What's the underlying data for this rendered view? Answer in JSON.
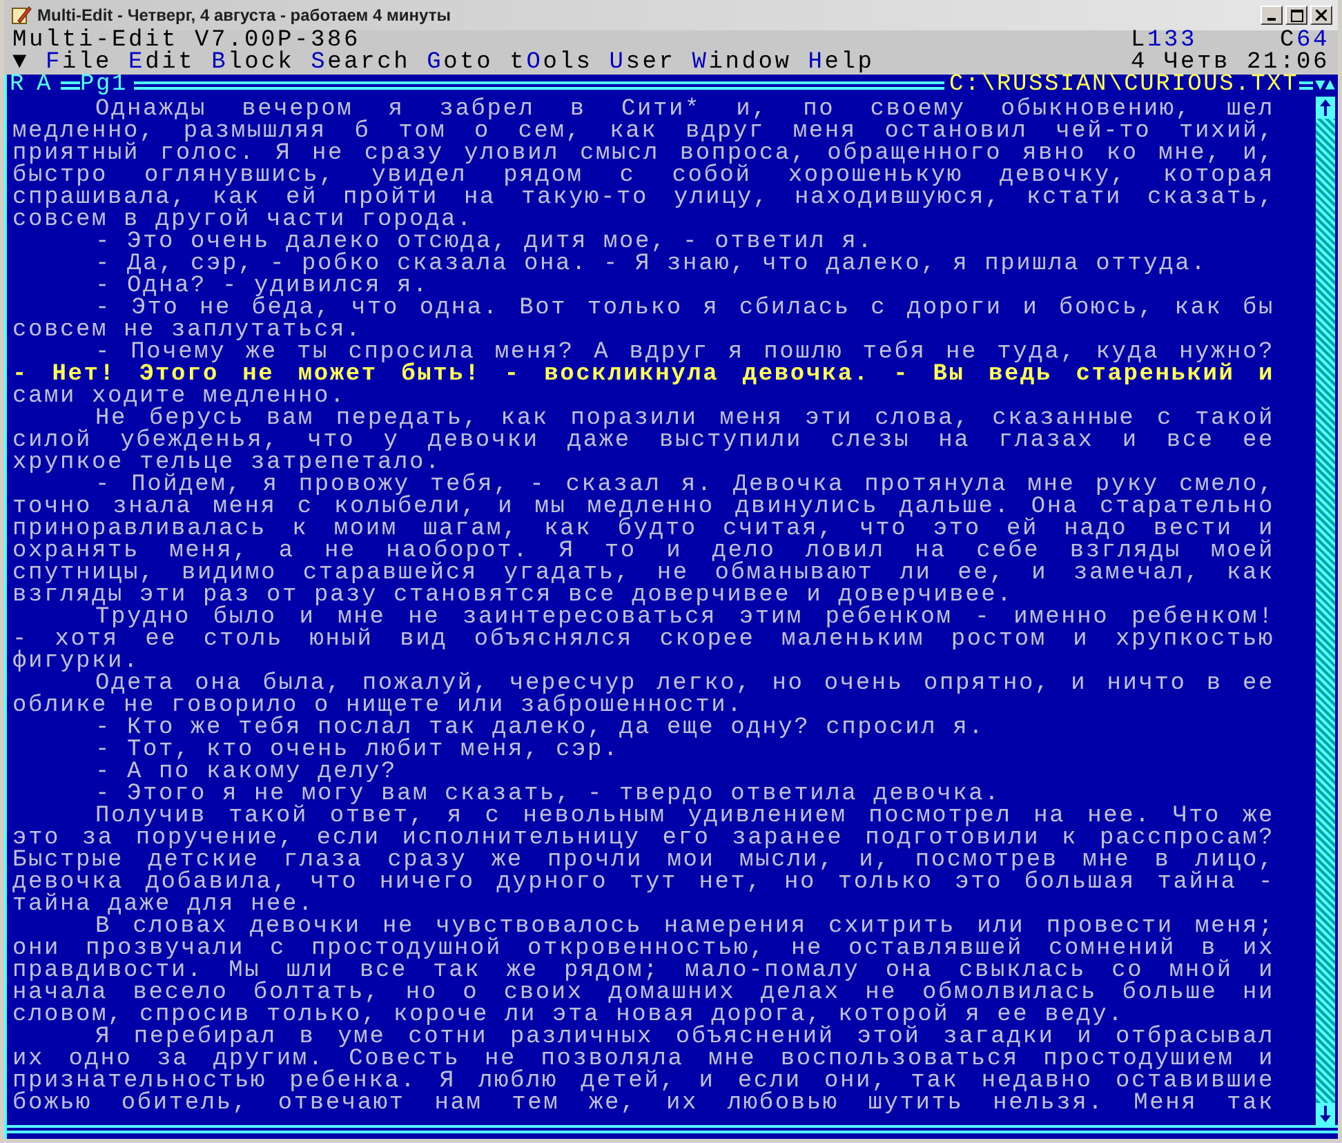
{
  "window": {
    "title": "Multi-Edit - Четверг, 4 августа - работаем 4 минуты"
  },
  "app_line": {
    "version": "Multi-Edit V7.00P-386",
    "line": {
      "label": "L",
      "value": "133"
    },
    "column": {
      "label": "C",
      "value": "64"
    }
  },
  "menu": {
    "arrow": "▼",
    "items": [
      {
        "key": "F",
        "post": "ile"
      },
      {
        "key": "E",
        "post": "dit"
      },
      {
        "key": "B",
        "post": "lock"
      },
      {
        "key": "S",
        "post": "earch"
      },
      {
        "key": "G",
        "post": "oto"
      },
      {
        "pre": "t",
        "key": "O",
        "post": "ols"
      },
      {
        "key": "U",
        "post": "ser"
      },
      {
        "key": "W",
        "post": "indow"
      },
      {
        "key": "H",
        "post": "elp"
      }
    ],
    "date": "4 Четв",
    "time": "21:06"
  },
  "frame": {
    "mode_r": "R",
    "mode_a": "A",
    "page": "Pg1",
    "path": "C:\\RUSSIAN\\CURIOUS.TXT",
    "arrows": "▼▲"
  },
  "lines": [
    {
      "text": "Однажды вечером я забрел в Сити* и, по своему обыкновению, шел",
      "indent": true,
      "justified": true,
      "highlighted": false
    },
    {
      "text": "медленно, размышляя б том о сем, как вдруг меня остановил чей-то тихий,",
      "indent": false,
      "justified": true,
      "highlighted": false
    },
    {
      "text": "приятный голос. Я не сразу уловил смысл вопроса, обращенного явно ко мне, и,",
      "indent": false,
      "justified": true,
      "highlighted": false
    },
    {
      "text": "быстро оглянувшись, увидел рядом с собой хорошенькую девочку, которая",
      "indent": false,
      "justified": true,
      "highlighted": false
    },
    {
      "text": "спрашивала, как ей пройти на такую-то улицу, находившуюся, кстати сказать,",
      "indent": false,
      "justified": true,
      "highlighted": false
    },
    {
      "text": "совсем в другой части города.",
      "indent": false,
      "justified": false,
      "highlighted": false
    },
    {
      "text": "- Это очень далеко отсюда, дитя мое, - ответил я.",
      "indent": true,
      "justified": false,
      "highlighted": false
    },
    {
      "text": "- Да, сэр, - робко сказала она. - Я знаю, что далеко, я пришла оттуда.",
      "indent": true,
      "justified": false,
      "highlighted": false
    },
    {
      "text": "- Одна? - удивился я.",
      "indent": true,
      "justified": false,
      "highlighted": false
    },
    {
      "text": "- Это не беда, что одна. Вот только я сбилась с дороги и боюсь, как бы",
      "indent": true,
      "justified": true,
      "highlighted": false
    },
    {
      "text": "совсем не заплутаться.",
      "indent": false,
      "justified": false,
      "highlighted": false
    },
    {
      "text": "- Почему же ты спросила меня? А вдруг я пошлю тебя не туда, куда нужно?",
      "indent": true,
      "justified": true,
      "highlighted": false
    },
    {
      "text": "- Нет! Этого не может быть! - воскликнула девочка. - Вы ведь старенький и",
      "indent": false,
      "justified": true,
      "highlighted": true
    },
    {
      "text": "сами ходите медленно.",
      "indent": false,
      "justified": false,
      "highlighted": false
    },
    {
      "text": "Не берусь вам передать, как поразили меня эти слова, сказанные с такой",
      "indent": true,
      "justified": true,
      "highlighted": false
    },
    {
      "text": "силой убежденья, что у девочки даже выступили слезы на глазах и все ее",
      "indent": false,
      "justified": true,
      "highlighted": false
    },
    {
      "text": "хрупкое тельце затрепетало.",
      "indent": false,
      "justified": false,
      "highlighted": false
    },
    {
      "text": "- Пойдем, я провожу тебя, - сказал я. Девочка протянула мне руку смело,",
      "indent": true,
      "justified": true,
      "highlighted": false
    },
    {
      "text": "точно знала меня с колыбели, и мы медленно двинулись дальше. Она старательно",
      "indent": false,
      "justified": true,
      "highlighted": false
    },
    {
      "text": "приноравливалась к моим шагам, как будто считая, что это ей надо вести и",
      "indent": false,
      "justified": true,
      "highlighted": false
    },
    {
      "text": "охранять меня, а не наоборот. Я то и дело ловил на себе взгляды моей",
      "indent": false,
      "justified": true,
      "highlighted": false
    },
    {
      "text": "спутницы, видимо старавшейся угадать, не обманывают ли ее, и замечал, как",
      "indent": false,
      "justified": true,
      "highlighted": false
    },
    {
      "text": "взгляды эти раз от разу становятся все доверчивее и доверчивее.",
      "indent": false,
      "justified": false,
      "highlighted": false
    },
    {
      "text": "Трудно было и мне не заинтересоваться этим ребенком - именно ребенком!",
      "indent": true,
      "justified": true,
      "highlighted": false
    },
    {
      "text": "- хотя ее столь юный вид объяснялся скорее маленьким ростом и хрупкостью",
      "indent": false,
      "justified": true,
      "highlighted": false
    },
    {
      "text": "фигурки.",
      "indent": false,
      "justified": false,
      "highlighted": false
    },
    {
      "text": "Одета она была, пожалуй, чересчур легко, но очень опрятно, и ничто в ее",
      "indent": true,
      "justified": true,
      "highlighted": false
    },
    {
      "text": "облике не говорило о нищете или заброшенности.",
      "indent": false,
      "justified": false,
      "highlighted": false
    },
    {
      "text": "- Кто же тебя послал так далеко, да еще одну? спросил я.",
      "indent": true,
      "justified": false,
      "highlighted": false
    },
    {
      "text": "- Тот, кто очень любит меня, сэр.",
      "indent": true,
      "justified": false,
      "highlighted": false
    },
    {
      "text": "- А по какому делу?",
      "indent": true,
      "justified": false,
      "highlighted": false
    },
    {
      "text": "- Этого я не могу вам сказать, - твердо ответила девочка.",
      "indent": true,
      "justified": false,
      "highlighted": false
    },
    {
      "text": "Получив такой ответ, я с невольным удивлением посмотрел на нее. Что же",
      "indent": true,
      "justified": true,
      "highlighted": false
    },
    {
      "text": "это за поручение, если исполнительницу его заранее подготовили к расспросам?",
      "indent": false,
      "justified": true,
      "highlighted": false
    },
    {
      "text": "Быстрые детские глаза сразу же прочли мои мысли, и, посмотрев мне в лицо,",
      "indent": false,
      "justified": true,
      "highlighted": false
    },
    {
      "text": "девочка добавила, что ничего дурного тут нет, но только это большая тайна -",
      "indent": false,
      "justified": true,
      "highlighted": false
    },
    {
      "text": "тайна даже для нее.",
      "indent": false,
      "justified": false,
      "highlighted": false
    },
    {
      "text": "В словах девочки не чувствовалось намерения схитрить или провести меня;",
      "indent": true,
      "justified": true,
      "highlighted": false
    },
    {
      "text": "они прозвучали с простодушной откровенностью, не оставлявшей сомнений в их",
      "indent": false,
      "justified": true,
      "highlighted": false
    },
    {
      "text": "правдивости. Мы шли все так же рядом; мало-помалу она свыклась со мной и",
      "indent": false,
      "justified": true,
      "highlighted": false
    },
    {
      "text": "начала весело болтать, но о своих домашних делах не обмолвилась больше ни",
      "indent": false,
      "justified": true,
      "highlighted": false
    },
    {
      "text": "словом, спросив только, короче ли эта новая дорога, которой я ее веду.",
      "indent": false,
      "justified": false,
      "highlighted": false
    },
    {
      "text": "Я перебирал в уме сотни различных объяснений этой загадки и отбрасывал",
      "indent": true,
      "justified": true,
      "highlighted": false
    },
    {
      "text": "их одно за другим. Совесть не позволяла мне воспользоваться простодушием и",
      "indent": false,
      "justified": true,
      "highlighted": false
    },
    {
      "text": "признательностью ребенка. Я люблю детей, и если они, так недавно оставившие",
      "indent": false,
      "justified": true,
      "highlighted": false
    },
    {
      "text": "божью обитель, отвечают нам тем же, их любовью шутить нельзя. Меня так",
      "indent": false,
      "justified": true,
      "highlighted": false
    }
  ]
}
